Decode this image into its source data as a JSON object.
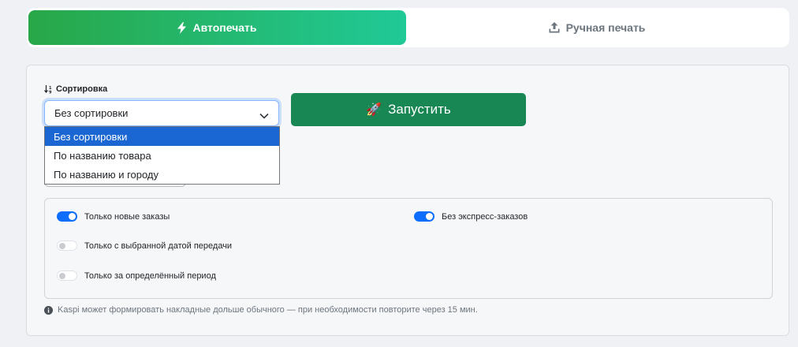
{
  "tabs": {
    "auto": {
      "label": "Автопечать",
      "icon": "lightning-icon",
      "active": true
    },
    "manual": {
      "label": "Ручная печать",
      "icon": "upload-icon",
      "active": false
    }
  },
  "sort": {
    "label": "Сортировка",
    "icon": "sort-icon",
    "selected": "Без сортировки",
    "options": [
      "Без сортировки",
      "По названию товара",
      "По названию и городу"
    ]
  },
  "run_button": {
    "label": "Запустить",
    "icon": "🚀"
  },
  "filters": [
    {
      "label": "Только новые заказы",
      "checked": true
    },
    {
      "label": "Без экспресс-заказов",
      "checked": true
    },
    {
      "label": "Только с выбранной датой передачи",
      "checked": false
    },
    {
      "label": "Только за определённый период",
      "checked": false
    }
  ],
  "note": {
    "icon": "info-icon",
    "text": "Kaspi может формировать накладные дольше обычного — при необходимости повторите через 15 мин."
  },
  "colors": {
    "accent_green_start": "#28a748",
    "accent_green_end": "#20c997",
    "run_button": "#198754",
    "toggle_on": "#0d6efd",
    "dropdown_highlight": "#1a66d2"
  }
}
